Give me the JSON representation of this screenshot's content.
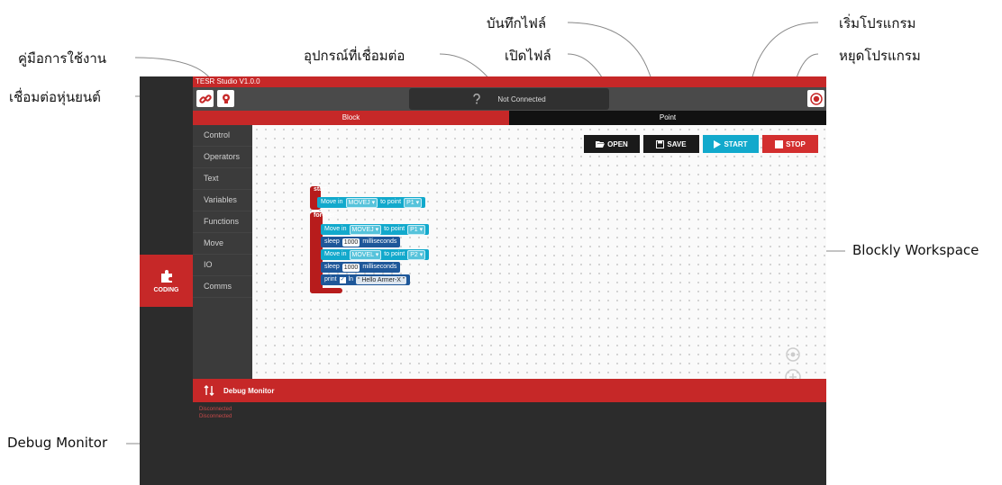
{
  "annotations": {
    "manual": "คู่มือการใช้งาน",
    "connect_robot": "เชื่อมต่อหุ่นยนต์",
    "connected_device": "อุปกรณ์ที่เชื่อมต่อ",
    "open_file": "เปิดไฟล์",
    "save_file": "บันทึกไฟล์",
    "start_program": "เริ่มโปรแกรม",
    "stop_program": "หยุดโปรแกรม",
    "blockly_workspace": "Blockly Workspace",
    "debug_monitor": "Debug Monitor"
  },
  "app": {
    "title": "TESR Studio V1.0.0",
    "connection_status": "Not Connected",
    "tabs": [
      "Block",
      "Point"
    ],
    "active_tab": "Block",
    "side_tab_label": "CODING",
    "toolbox": [
      "Control",
      "Operators",
      "Text",
      "Variables",
      "Functions",
      "Move",
      "IO",
      "Comms"
    ],
    "actions": {
      "open": "OPEN",
      "save": "SAVE",
      "start": "START",
      "stop": "STOP"
    },
    "blocks": {
      "start_label": "start:",
      "forever_label": "forever:",
      "move_in": "Move in",
      "to_point": "to point",
      "movej": "MOVEJ",
      "movel": "MOVEL",
      "p1": "P1",
      "p2": "P2",
      "sleep": "sleep",
      "ms_value": "1000",
      "milliseconds": "milliseconds",
      "print": "print",
      "ln": "ln",
      "print_text": "Hello Armer-X"
    },
    "debug": {
      "title": "Debug Monitor",
      "lines": [
        "Disconnected",
        "Disconnected"
      ]
    }
  },
  "colors": {
    "brand_red": "#c62828",
    "block_cyan": "#12a9cc",
    "start_button": "#12a9cc",
    "stop_button": "#d32f2f"
  }
}
